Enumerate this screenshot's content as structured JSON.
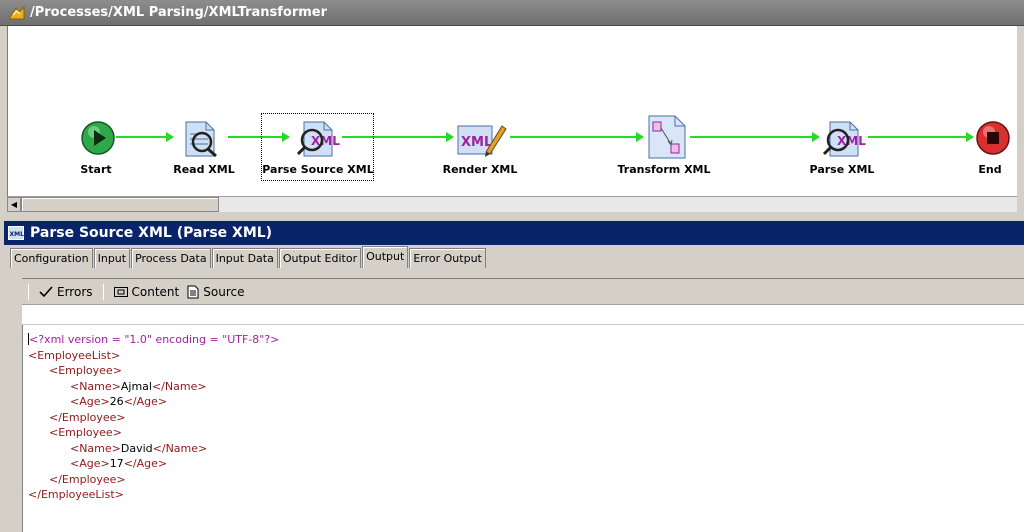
{
  "process_window": {
    "title": "/Processes/XML Parsing/XMLTransformer"
  },
  "nodes": [
    {
      "label": "Start",
      "icon": "start-icon"
    },
    {
      "label": "Read XML",
      "icon": "read-xml-icon"
    },
    {
      "label": "Parse Source XML",
      "icon": "parse-xml-icon"
    },
    {
      "label": "Render XML",
      "icon": "render-xml-icon"
    },
    {
      "label": "Transform XML",
      "icon": "transform-xml-icon"
    },
    {
      "label": "Parse XML",
      "icon": "parse-xml-icon"
    },
    {
      "label": "End",
      "icon": "end-icon"
    }
  ],
  "panel": {
    "title": "Parse Source XML (Parse XML)",
    "tabs": [
      {
        "label": "Configuration"
      },
      {
        "label": "Input"
      },
      {
        "label": "Process Data"
      },
      {
        "label": "Input Data"
      },
      {
        "label": "Output Editor"
      },
      {
        "label": "Output",
        "active": true
      },
      {
        "label": "Error Output"
      }
    ],
    "toolbar": {
      "errors": "Errors",
      "content": "Content",
      "source": "Source"
    }
  },
  "xml_output": {
    "declaration": "<?xml version = \"1.0\" encoding = \"UTF-8\"?>",
    "root_tag": "EmployeeList",
    "child_tag": "Employee",
    "name_tag": "Name",
    "age_tag": "Age",
    "employees": [
      {
        "name": "Ajmal",
        "age": "26"
      },
      {
        "name": "David",
        "age": "17"
      }
    ]
  },
  "colors": {
    "flow": "#22dd22",
    "panel_title_bg": "#0a246a",
    "xml_tag": "#8b1a1a",
    "xml_pi": "#a020a0"
  }
}
